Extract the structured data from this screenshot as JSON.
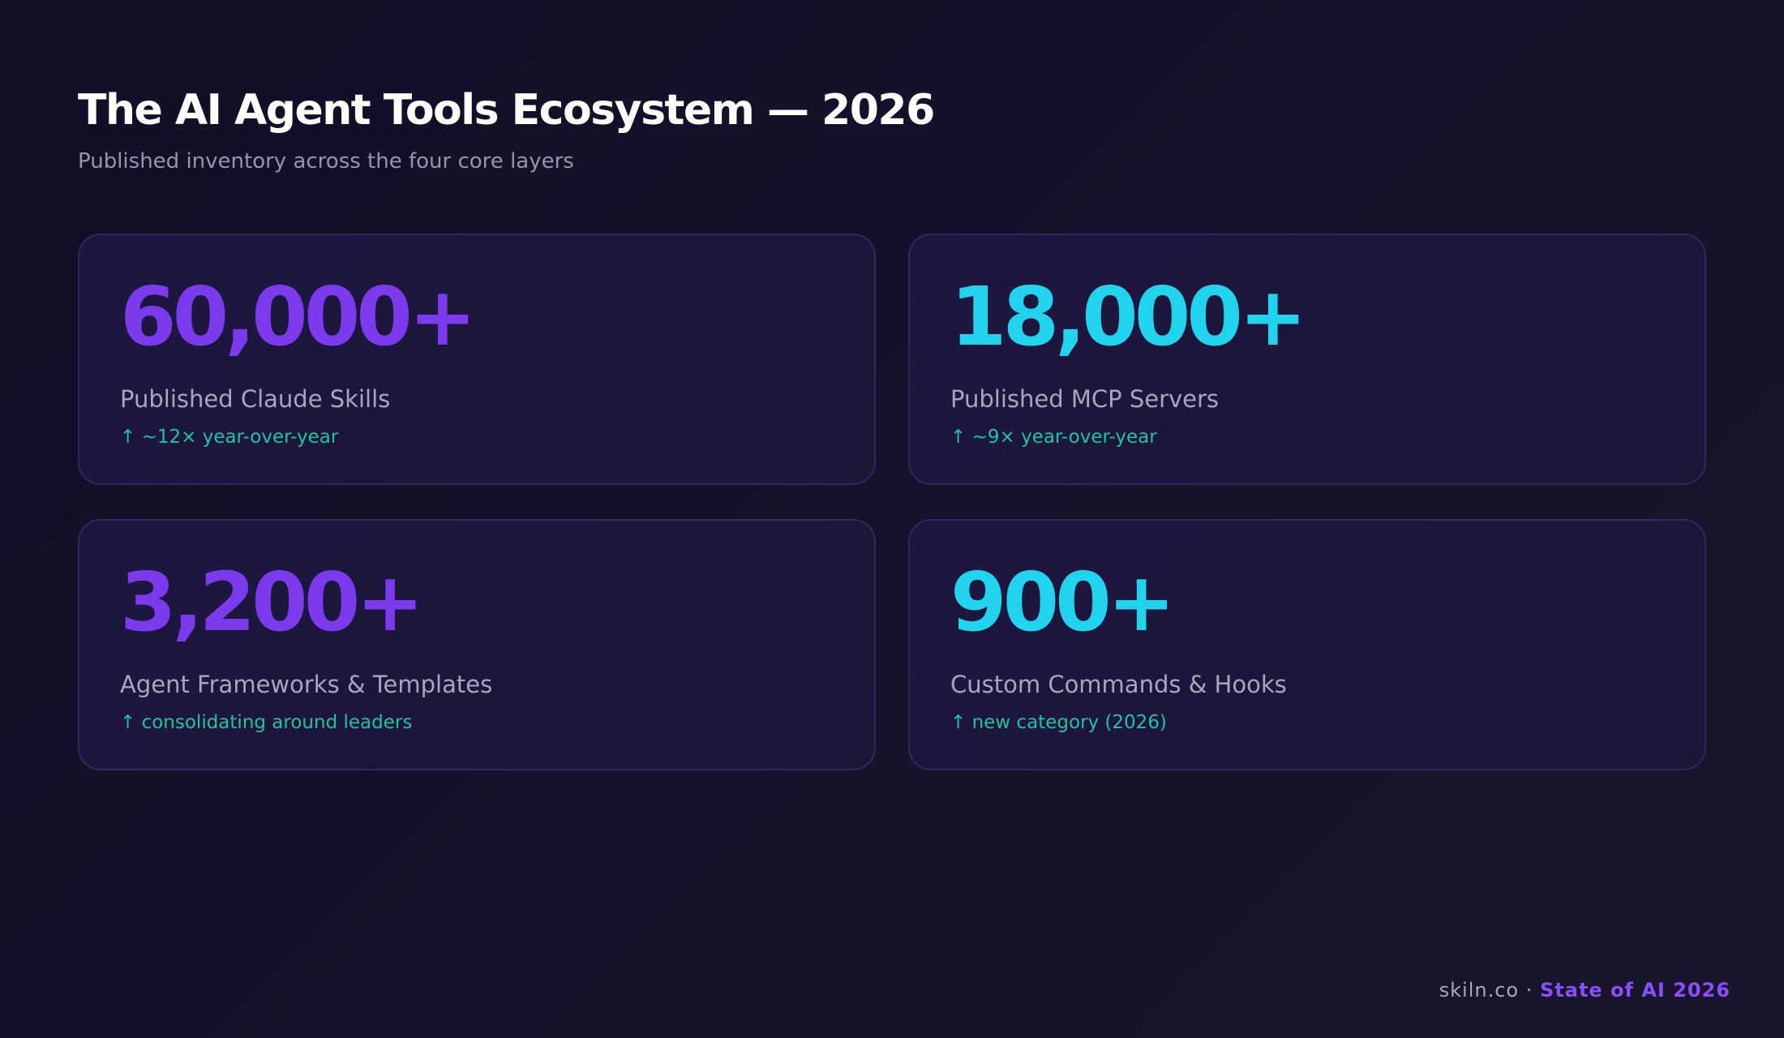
{
  "header": {
    "title": "The AI Agent Tools Ecosystem — 2026",
    "subtitle": "Published inventory across the four core layers"
  },
  "colors": {
    "background": "#121028",
    "card": "#1d1640",
    "card_border": "#33285e",
    "purple_accent": "#7c3aed",
    "cyan_accent": "#22d3ee",
    "trend_green": "#20c3a0",
    "label_gray": "#a9a5bc"
  },
  "stats": [
    {
      "value": "60,000+",
      "label": "Published Claude Skills",
      "trend": "↑ ~12× year-over-year",
      "color": "#7c3aed"
    },
    {
      "value": "18,000+",
      "label": "Published MCP Servers",
      "trend": "↑ ~9× year-over-year",
      "color": "#22d3ee"
    },
    {
      "value": "3,200+",
      "label": "Agent Frameworks & Templates",
      "trend": "↑ consolidating around leaders",
      "color": "#7c3aed"
    },
    {
      "value": "900+",
      "label": "Custom Commands & Hooks",
      "trend": "↑ new category (2026)",
      "color": "#22d3ee"
    }
  ],
  "footer": {
    "site": "skiln.co",
    "separator": " · ",
    "report": "State of AI 2026"
  }
}
